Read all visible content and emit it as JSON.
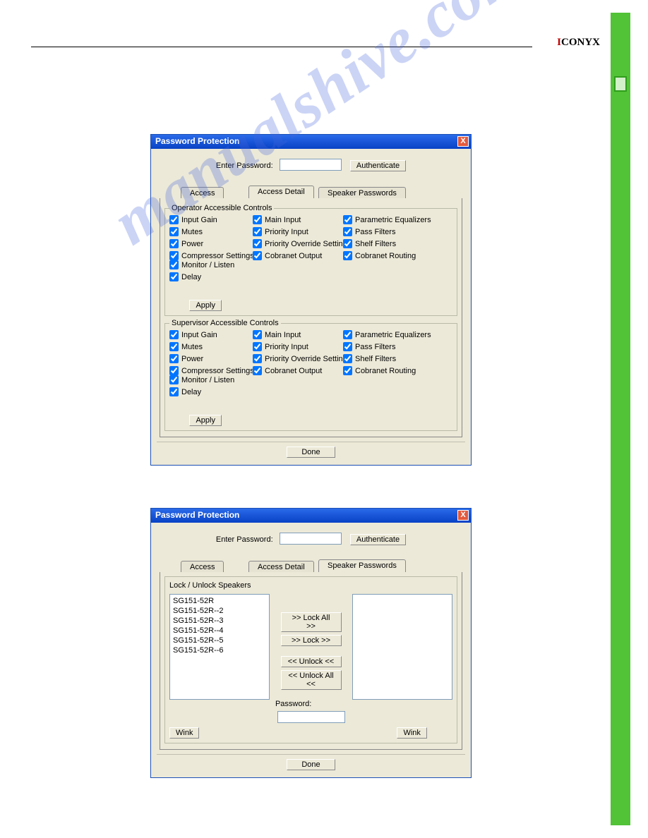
{
  "brand": {
    "accent": "I",
    "rest": "CONYX"
  },
  "watermark": "manualshive.com",
  "dialog": {
    "title": "Password Protection",
    "close_x": "X",
    "enter_password_label": "Enter Password:",
    "authenticate_label": "Authenticate",
    "done_label": "Done",
    "tabs": {
      "access": "Access",
      "access_detail": "Access Detail",
      "speaker_passwords": "Speaker Passwords"
    }
  },
  "access_detail": {
    "operator_legend": "Operator Accessible Controls",
    "supervisor_legend": "Supervisor Accessible Controls",
    "apply_label": "Apply",
    "cols": {
      "c1": [
        "Input Gain",
        "Mutes",
        "Power",
        "Compressor Settings"
      ],
      "c2": [
        "Main Input",
        "Priority Input",
        "Priority Override Settings",
        "Cobranet Output"
      ],
      "c3": [
        "Parametric Equalizers",
        "Pass Filters",
        "Shelf Filters",
        "Cobranet Routing"
      ],
      "c4": [
        "Monitor / Listen",
        "Delay"
      ]
    }
  },
  "speaker_passwords": {
    "group_title": "Lock / Unlock Speakers",
    "speakers": [
      "SG151-52R",
      "SG151-52R--2",
      "SG151-52R--3",
      "SG151-52R--4",
      "SG151-52R--5",
      "SG151-52R--6"
    ],
    "buttons": {
      "lock_all": ">> Lock All >>",
      "lock": ">> Lock >>",
      "unlock": "<< Unlock <<",
      "unlock_all": "<< Unlock All <<"
    },
    "password_label": "Password:",
    "wink_label": "Wink"
  }
}
